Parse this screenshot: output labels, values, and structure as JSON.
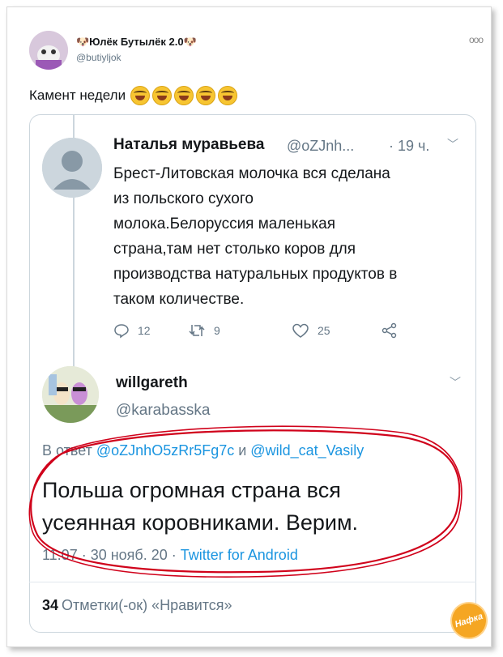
{
  "top_tweet": {
    "name": "🐶Юлёк Бутылёк 2.0🐶",
    "handle": "@butiyljok",
    "more": "ооо",
    "text": "Камент недели"
  },
  "quoted_tweet": {
    "name": "Наталья муравьева",
    "handle": "@oZJnh...",
    "time": "· 19 ч.",
    "chevron": "﹀",
    "body_lines": [
      "Брест-Литовская молочка вся сделана",
      "из польского сухого",
      "молока.Белоруссия маленькая",
      "страна,там нет столько коров для",
      "производства натуральных продуктов в",
      "таком количестве."
    ],
    "actions": {
      "reply_count": "12",
      "retweet_count": "9",
      "like_count": "25"
    }
  },
  "reply_tweet": {
    "name": "willgareth",
    "handle": "@karabasska",
    "chevron": "﹀",
    "reply_prefix": "В ответ ",
    "reply_mention_1": "@oZJnhO5zRr5Fg7c",
    "reply_and": " и ",
    "reply_mention_2": "@wild_cat_Vasily",
    "body_lines": [
      "Польша огромная страна вся",
      "усеянная коровниками. Верим."
    ],
    "meta_time": "11:07 · 30 нояб. 20 · ",
    "meta_source": "Twitter for Android",
    "likes_count": "34",
    "likes_label": "Отметки(-ок) «Нравится»"
  },
  "watermark": "Нафка",
  "colors": {
    "link": "#1b95e0",
    "muted": "#657786",
    "annotation": "#d0021b"
  }
}
